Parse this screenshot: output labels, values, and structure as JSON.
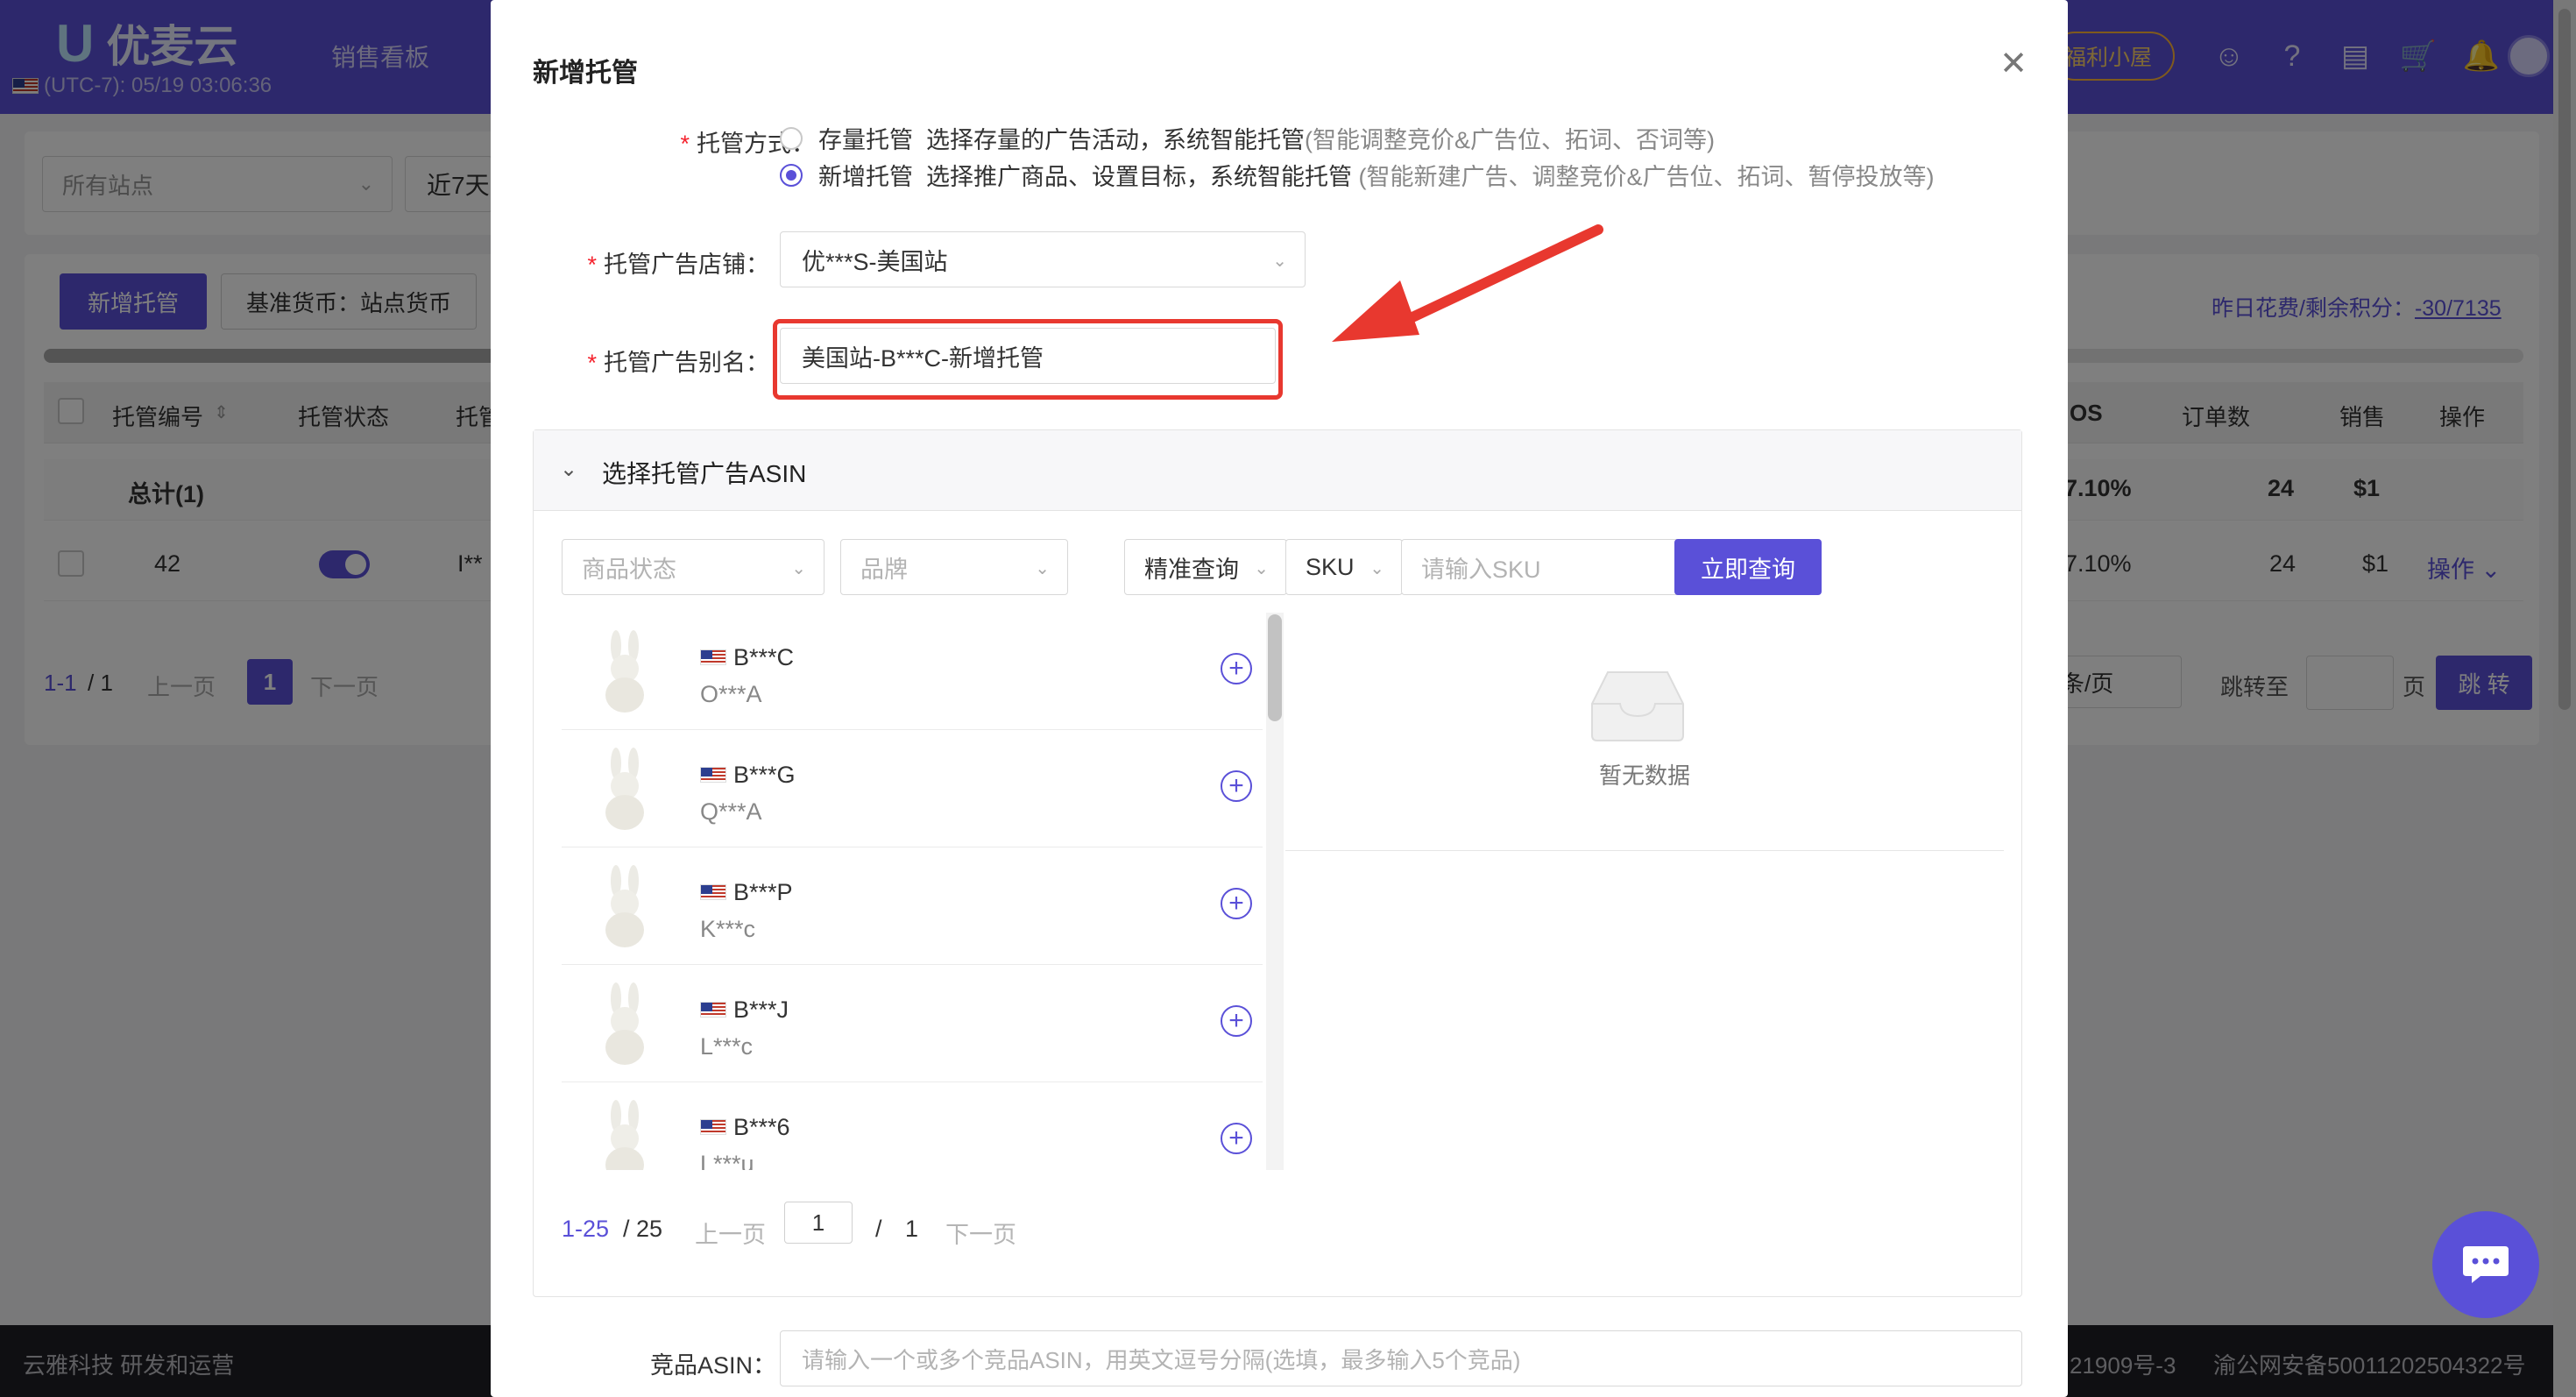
{
  "app": {
    "logo_text": "优麦云",
    "clock": "(UTC-7): 05/19 03:06:36",
    "nav_sales": "销售看板",
    "welfare": "福利小屋",
    "icons": [
      "user-circle-icon",
      "help-icon",
      "message-icon",
      "cart-icon",
      "bell-icon"
    ],
    "accent_color": "#5a50d8"
  },
  "filters": {
    "site_placeholder": "所有站点",
    "days": "近7天"
  },
  "toolbar": {
    "new_button": "新增托管",
    "currency_button": "基准货币：站点货币",
    "credit_label": "昨日花费/剩余积分：",
    "credit_value": "-30/7135"
  },
  "table": {
    "headers": [
      "托管编号",
      "托管状态",
      "托管",
      "OS",
      "订单数",
      "销售",
      "操作"
    ],
    "total_label": "总计(1)",
    "total_acos": "7.10%",
    "total_orders": "24",
    "total_sales": "$1",
    "row": {
      "id": "42",
      "acos": "7.10%",
      "orders": "24",
      "sales": "$1",
      "action": "操作",
      "col3": "I**"
    }
  },
  "bg_pagination": {
    "range": "1-1",
    "total": "/ 1",
    "prev": "上一页",
    "page": "1",
    "next": "下一页",
    "per_page": "条/页",
    "jump_label": "跳转至",
    "page_unit": "页",
    "jump_button": "跳 转"
  },
  "footer": {
    "left": "云雅科技 研发和运营",
    "right_a": "21909号-3",
    "right_b": "渝公网安备50011202504322号"
  },
  "modal": {
    "title": "新增托管",
    "mode_label": "托管方式：",
    "mode_options": [
      {
        "name": "存量托管",
        "desc": "选择存量的广告活动，系统智能托管",
        "hint": "(智能调整竞价&广告位、拓词、否词等)",
        "selected": false
      },
      {
        "name": "新增托管",
        "desc": "选择推广商品、设置目标，系统智能托管",
        "hint": "(智能新建广告、调整竞价&广告位、拓词、暂停投放等)",
        "selected": true
      }
    ],
    "store_label": "托管广告店铺：",
    "store_value": "优***S-美国站",
    "alias_label": "托管广告别名：",
    "alias_value": "美国站-B***C-新增托管",
    "section_title": "选择托管广告ASIN",
    "filter_status": "商品状态",
    "filter_brand": "品牌",
    "filter_match": "精准查询",
    "filter_field": "SKU",
    "sku_placeholder": "请输入SKU",
    "search_button": "立即查询",
    "products": [
      {
        "asin": "B***C",
        "sku": "O***A"
      },
      {
        "asin": "B***G",
        "sku": "Q***A"
      },
      {
        "asin": "B***P",
        "sku": "K***c"
      },
      {
        "asin": "B***J",
        "sku": "L***c"
      },
      {
        "asin": "B***6",
        "sku": "L***u"
      }
    ],
    "empty_text": "暂无数据",
    "pager": {
      "range": "1-25",
      "total": "/ 25",
      "prev": "上一页",
      "page": "1",
      "slash": "/",
      "pages": "1",
      "next": "下一页"
    },
    "competitor_label": "竞品ASIN：",
    "competitor_placeholder": "请输入一个或多个竞品ASIN，用英文逗号分隔(选填，最多输入5个竞品)"
  }
}
